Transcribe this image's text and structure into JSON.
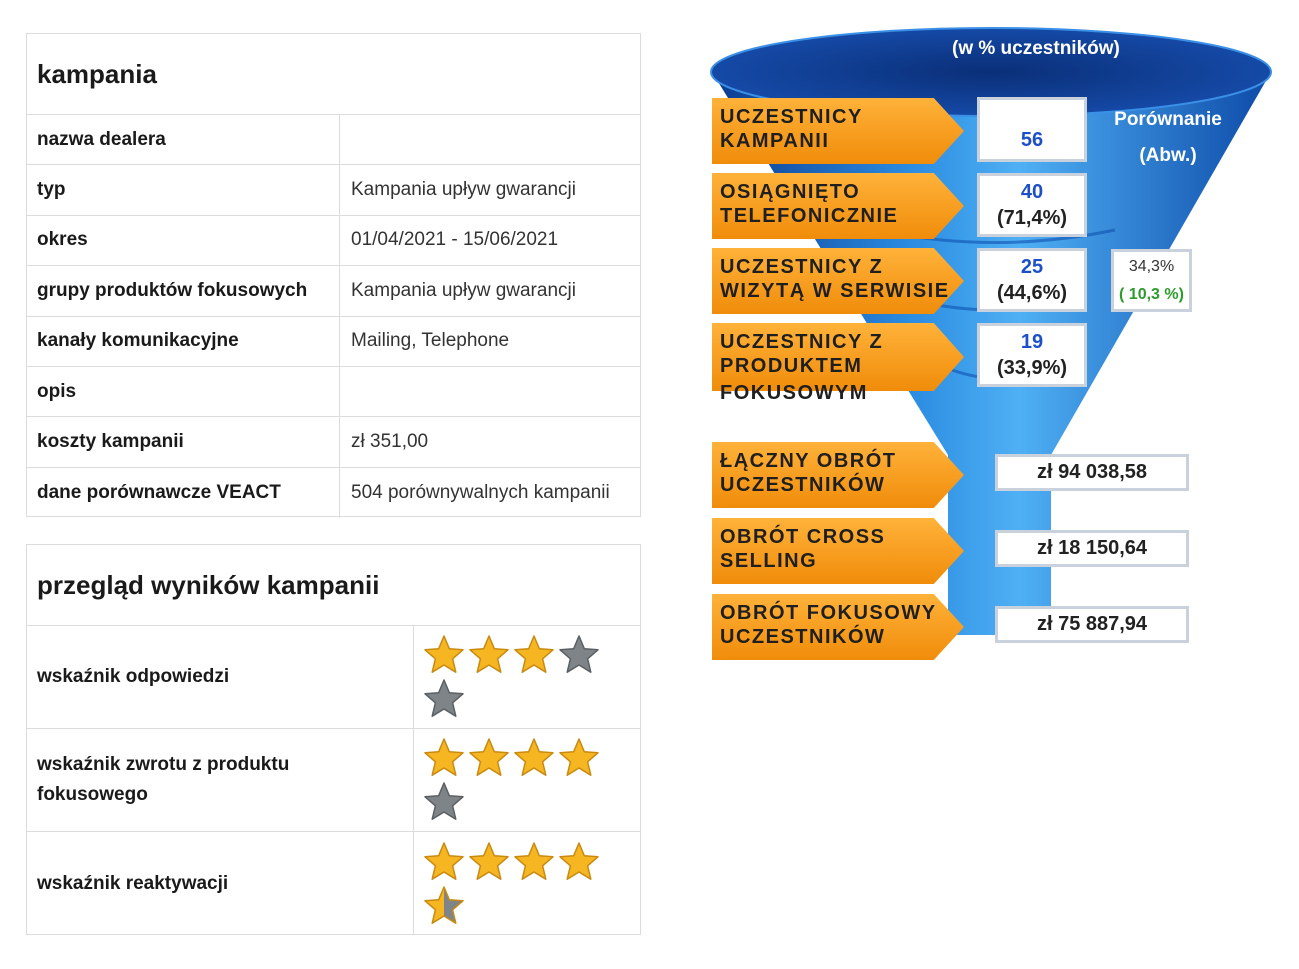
{
  "campaign": {
    "title": "kampania",
    "rows": [
      {
        "label": "nazwa dealera",
        "value": ""
      },
      {
        "label": "typ",
        "value": "Kampania upływ gwarancji"
      },
      {
        "label": "okres",
        "value": "01/04/2021 - 15/06/2021"
      },
      {
        "label": "grupy produktów fokusowych",
        "value": "Kampania upływ gwarancji"
      },
      {
        "label": "kanały komunikacyjne",
        "value": "Mailing, Telephone"
      },
      {
        "label": "opis",
        "value": ""
      },
      {
        "label": "koszty kampanii",
        "value": "zł 351,00"
      },
      {
        "label": "dane porównawcze VEACT",
        "value": "504 porównywalnych kampanii"
      }
    ]
  },
  "review": {
    "title": "przegląd wyników kampanii",
    "rows": [
      {
        "label": "wskaźnik odpowiedzi",
        "rating": 3
      },
      {
        "label": "wskaźnik zwrotu z produktu fokusowego",
        "rating": 4
      },
      {
        "label": "wskaźnik reaktywacji",
        "rating": 4.5
      }
    ],
    "max_rating": 5
  },
  "funnel": {
    "header": "(w % uczestników)",
    "compare_label_1": "Porównanie",
    "compare_label_2": "(Abw.)",
    "stages": [
      {
        "label_1": "UCZESTNICY",
        "label_2": "KAMPANII",
        "label_3": "",
        "value": "56",
        "percent": ""
      },
      {
        "label_1": "OSIĄGNIĘTO",
        "label_2": "TELEFONICZNIE",
        "label_3": "",
        "value": "40",
        "percent": "(71,4%)"
      },
      {
        "label_1": "UCZESTNICY Z",
        "label_2": "WIZYTĄ W SERWISIE",
        "label_3": "",
        "value": "25",
        "percent": "(44,6%)"
      },
      {
        "label_1": "UCZESTNICY Z",
        "label_2": "PRODUKTEM",
        "label_3": "FOKUSOWYM",
        "value": "19",
        "percent": "(33,9%)"
      }
    ],
    "comparison": {
      "value": "34,3%",
      "delta": "( 10,3 %)"
    },
    "totals": [
      {
        "label_1": "ŁĄCZNY OBRÓT",
        "label_2": "UCZESTNIKÓW",
        "value": "zł 94 038,58"
      },
      {
        "label_1": "OBRÓT CROSS",
        "label_2": "SELLING",
        "value": "zł 18 150,64"
      },
      {
        "label_1": "OBRÓT FOKUSOWY",
        "label_2": "UCZESTNIKÓW",
        "value": "zł 75 887,94"
      }
    ]
  },
  "colors": {
    "funnel_dark": "#0c3a8c",
    "funnel_light": "#3a9be8",
    "label_orange": "#f5a020",
    "value_blue": "#1d50c8",
    "delta_green": "#2e9b2e",
    "star_gold": "#f6b621",
    "star_grey": "#7f8488"
  }
}
